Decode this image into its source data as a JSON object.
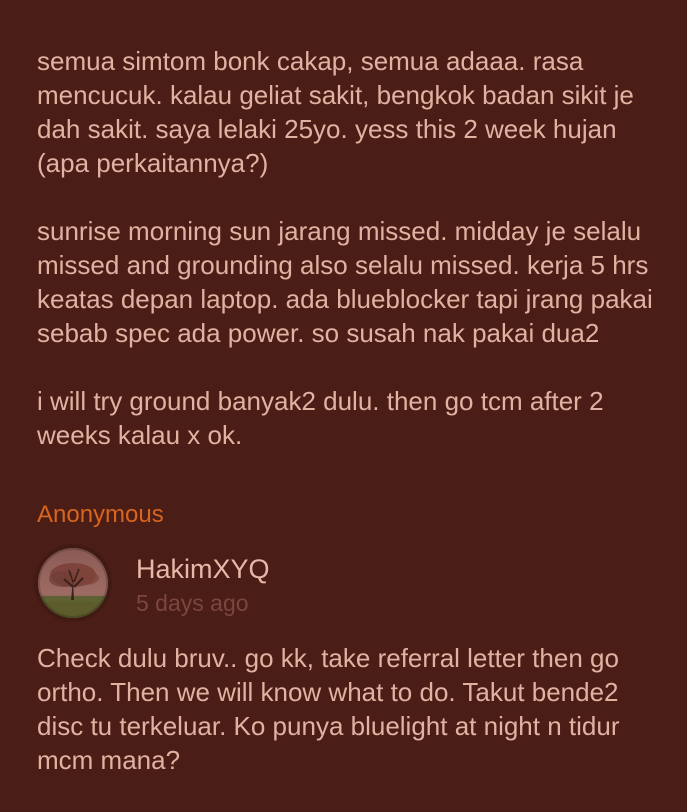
{
  "thread": {
    "message": {
      "paragraphs": [
        "semua simtom bonk cakap, semua adaaa. rasa mencucuk. kalau geliat sakit, bengkok badan sikit je dah sakit. saya lelaki 25yo. yess this 2 week hujan (apa perkaitannya?)",
        "sunrise morning sun jarang missed. midday je selalu missed and grounding also selalu missed. kerja 5 hrs keatas depan laptop. ada blueblocker tapi jrang pakai sebab spec ada power. so susah nak pakai dua2",
        "i will try ground banyak2 dulu. then go tcm after 2 weeks kalau x ok."
      ],
      "author_label": "Anonymous"
    },
    "reply": {
      "author": "HakimXYQ",
      "timestamp": "5 days ago",
      "text": "Check dulu bruv.. go kk, take referral letter then go ortho. Then we will know what to do. Takut bende2 disc tu terkeluar. Ko punya bluelight at night n tidur mcm mana?"
    }
  },
  "colors": {
    "background": "#4a1d17",
    "text": "#e1b1a1",
    "accent": "#d8651d",
    "muted": "#7c463d"
  },
  "icons": {
    "avatar": "profile-photo-tree"
  }
}
